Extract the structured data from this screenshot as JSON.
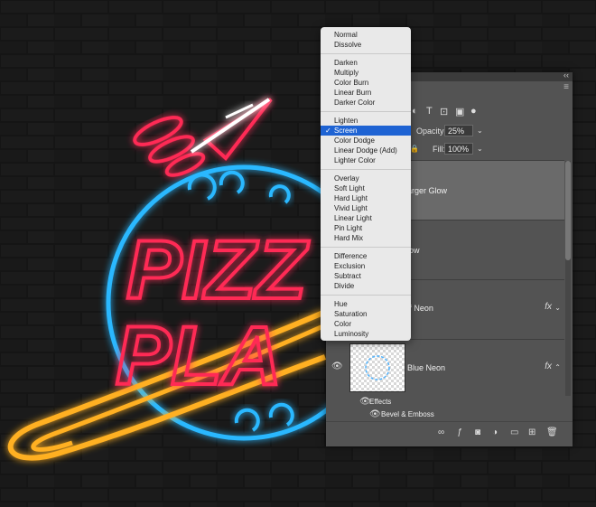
{
  "blend_menu": {
    "groups": [
      [
        "Normal",
        "Dissolve"
      ],
      [
        "Darken",
        "Multiply",
        "Color Burn",
        "Linear Burn",
        "Darker Color"
      ],
      [
        "Lighten",
        "Screen",
        "Color Dodge",
        "Linear Dodge (Add)",
        "Lighter Color"
      ],
      [
        "Overlay",
        "Soft Light",
        "Hard Light",
        "Vivid Light",
        "Linear Light",
        "Pin Light",
        "Hard Mix"
      ],
      [
        "Difference",
        "Exclusion",
        "Subtract",
        "Divide"
      ],
      [
        "Hue",
        "Saturation",
        "Color",
        "Luminosity"
      ]
    ],
    "selected": "Screen",
    "check": "✓"
  },
  "layers_panel": {
    "opacity_label": "Opacity:",
    "opacity_value": "25%",
    "fill_label": "Fill:",
    "fill_value": "100%",
    "layers": [
      {
        "name": "arger Glow",
        "fx": ""
      },
      {
        "name": "low",
        "fx": ""
      },
      {
        "name": "ff Neon",
        "fx": "fx"
      },
      {
        "name": "Blue Neon",
        "fx": "fx"
      }
    ],
    "effects_label": "Effects",
    "effect_items": [
      "Bevel & Emboss"
    ],
    "collapse_glyph": "‹‹"
  },
  "artwork": {
    "line1": "PIZZ",
    "line2": "PLA",
    "colors": {
      "red": "#ff2a55",
      "blue": "#2ab8ff",
      "orange": "#ffb020",
      "white": "#ffffff"
    }
  }
}
